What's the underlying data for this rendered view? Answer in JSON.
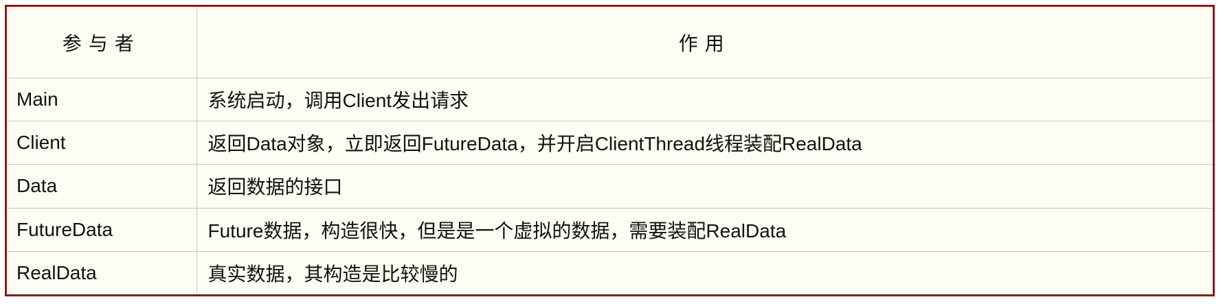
{
  "table": {
    "headers": [
      "参与者",
      "作用"
    ],
    "rows": [
      {
        "participant": "Main",
        "role": "系统启动，调用Client发出请求"
      },
      {
        "participant": "Client",
        "role": "返回Data对象，立即返回FutureData，并开启ClientThread线程装配RealData"
      },
      {
        "participant": "Data",
        "role": "返回数据的接口"
      },
      {
        "participant": "FutureData",
        "role": "Future数据，构造很快，但是是一个虚拟的数据，需要装配RealData"
      },
      {
        "participant": "RealData",
        "role": "真实数据，其构造是比较慢的"
      }
    ]
  },
  "colors": {
    "border": "#8b1a1a",
    "background": "#fefdf3",
    "grid": "#c8c8c4"
  }
}
